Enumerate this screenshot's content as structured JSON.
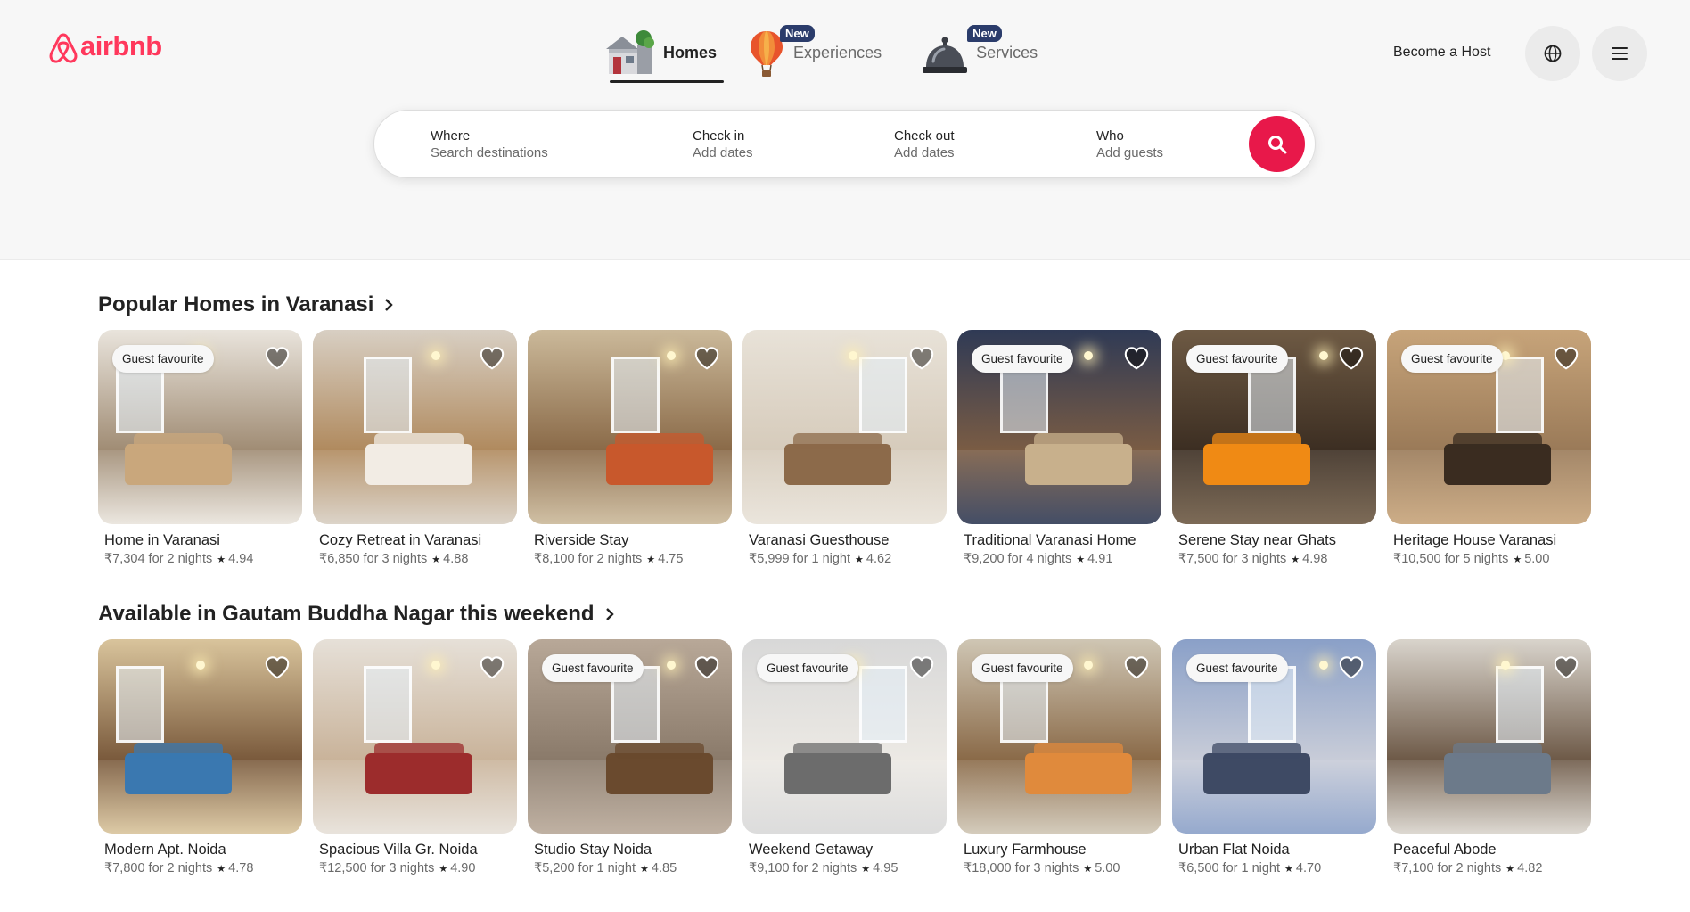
{
  "brand": {
    "name": "airbnb",
    "color": "#ff385c"
  },
  "nav": {
    "homes": {
      "label": "Homes",
      "icon": "house-icon"
    },
    "experiences": {
      "label": "Experiences",
      "badge": "New",
      "icon": "hot-air-balloon-icon"
    },
    "services": {
      "label": "Services",
      "badge": "New",
      "icon": "service-bell-icon"
    }
  },
  "header": {
    "host_label": "Become a Host",
    "globe_icon": "globe-icon",
    "menu_icon": "menu-icon"
  },
  "search": {
    "where": {
      "title": "Where",
      "placeholder": "Search destinations"
    },
    "check_in": {
      "title": "Check in",
      "placeholder": "Add dates"
    },
    "check_out": {
      "title": "Check out",
      "placeholder": "Add dates"
    },
    "who": {
      "title": "Who",
      "placeholder": "Add guests"
    },
    "button_icon": "search-icon",
    "button_color": "#e8184a"
  },
  "sections": [
    {
      "title": "Popular Homes in Varanasi",
      "cards": [
        {
          "title": "Home in Varanasi",
          "price": "₹7,304 for 2 nights",
          "rating": "4.94",
          "badge": "Guest favourite"
        },
        {
          "title": "Cozy Retreat in Varanasi",
          "price": "₹6,850 for 3 nights",
          "rating": "4.88",
          "badge": ""
        },
        {
          "title": "Riverside Stay",
          "price": "₹8,100 for 2 nights",
          "rating": "4.75",
          "badge": ""
        },
        {
          "title": "Varanasi Guesthouse",
          "price": "₹5,999 for 1 night",
          "rating": "4.62",
          "badge": ""
        },
        {
          "title": "Traditional Varanasi Home",
          "price": "₹9,200 for 4 nights",
          "rating": "4.91",
          "badge": "Guest favourite"
        },
        {
          "title": "Serene Stay near Ghats",
          "price": "₹7,500 for 3 nights",
          "rating": "4.98",
          "badge": "Guest favourite"
        },
        {
          "title": "Heritage House Varanasi",
          "price": "₹10,500 for 5 nights",
          "rating": "5.00",
          "badge": "Guest favourite"
        }
      ]
    },
    {
      "title": "Available in Gautam Buddha Nagar this weekend",
      "cards": [
        {
          "title": "Modern Apt. Noida",
          "price": "₹7,800 for 2 nights",
          "rating": "4.78",
          "badge": ""
        },
        {
          "title": "Spacious Villa Gr. Noida",
          "price": "₹12,500 for 3 nights",
          "rating": "4.90",
          "badge": ""
        },
        {
          "title": "Studio Stay Noida",
          "price": "₹5,200 for 1 night",
          "rating": "4.85",
          "badge": "Guest favourite"
        },
        {
          "title": "Weekend Getaway",
          "price": "₹9,100 for 2 nights",
          "rating": "4.95",
          "badge": "Guest favourite"
        },
        {
          "title": "Luxury Farmhouse",
          "price": "₹18,000 for 3 nights",
          "rating": "5.00",
          "badge": "Guest favourite"
        },
        {
          "title": "Urban Flat Noida",
          "price": "₹6,500 for 1 night",
          "rating": "4.70",
          "badge": "Guest favourite"
        },
        {
          "title": "Peaceful Abode",
          "price": "₹7,100 for 2 nights",
          "rating": "4.82",
          "badge": ""
        }
      ]
    }
  ],
  "palette": {
    "scenes": [
      [
        "#e9e4dc",
        "#a08c74",
        "#c9a77c"
      ],
      [
        "#d8cfc3",
        "#b08a5e",
        "#f2ece4"
      ],
      [
        "#cbb99a",
        "#8a6a48",
        "#c8582c"
      ],
      [
        "#e8e2d8",
        "#d6cbbb",
        "#8c6a4a"
      ],
      [
        "#2f3a55",
        "#7a5c44",
        "#c8b08c"
      ],
      [
        "#6e5a44",
        "#3c2e22",
        "#f08a14"
      ],
      [
        "#c7a47a",
        "#9a7a58",
        "#3a2c20"
      ],
      [
        "#d9c49c",
        "#7a5a3c",
        "#3a78b0"
      ],
      [
        "#e6e0d8",
        "#c9b39a",
        "#9c2c2c"
      ],
      [
        "#b8a898",
        "#8a7a6a",
        "#6a4a2e"
      ],
      [
        "#d8d8d8",
        "#ece9e4",
        "#6c6c6c"
      ],
      [
        "#cfc6b4",
        "#8a6a48",
        "#e08a3c"
      ],
      [
        "#8aa0c8",
        "#c8ccd8",
        "#3e4a64"
      ],
      [
        "#d9d4cc",
        "#6e5a48",
        "#6c7a8a"
      ]
    ]
  }
}
